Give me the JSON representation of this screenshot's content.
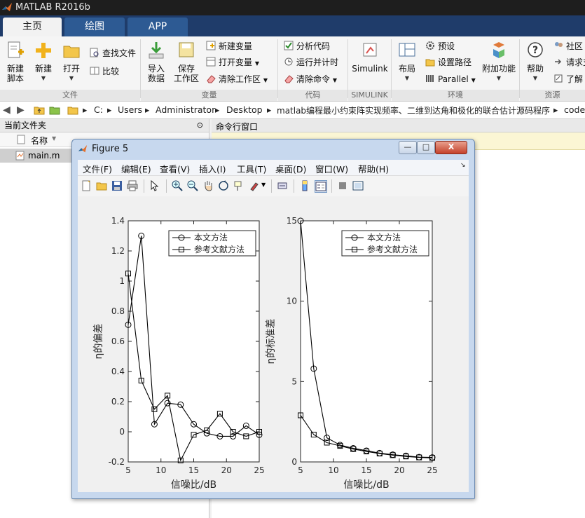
{
  "app": {
    "title": "MATLAB R2016b"
  },
  "tabs": [
    {
      "label": "主页"
    },
    {
      "label": "绘图"
    },
    {
      "label": "APP"
    }
  ],
  "ribbon": {
    "groups": [
      "文件",
      "变量",
      "代码",
      "SIMULINK",
      "环境",
      "资源"
    ],
    "new_script": "新建\n脚本",
    "new": "新建",
    "open": "打开",
    "find_files": "查找文件",
    "compare": "比较",
    "import_data": "导入\n数据",
    "save_workspace": "保存\n工作区",
    "new_variable": "新建变量",
    "open_variable": "打开变量",
    "clear_workspace": "清除工作区",
    "analyze_code": "分析代码",
    "run_and_time": "运行并计时",
    "clear_commands": "清除命令",
    "simulink": "Simulink",
    "layout": "布局",
    "preferences": "预设",
    "set_path": "设置路径",
    "parallel": "Parallel",
    "addons": "附加功能",
    "help": "帮助",
    "community": "社区",
    "request_support": "请求支",
    "learn": "了解"
  },
  "address": {
    "crumbs": [
      "C:",
      "Users",
      "Administrator",
      "Desktop",
      "matlab编程最小约束阵实现频率、二维到达角和极化的联合估计源码程序",
      "code"
    ]
  },
  "left_panel": {
    "title": "当前文件夹",
    "column_name": "名称",
    "files": [
      {
        "name": "main.m"
      }
    ]
  },
  "command_window": {
    "title": "命令行窗口"
  },
  "figure": {
    "title": "Figure 5",
    "menus": [
      "文件(F)",
      "编辑(E)",
      "查看(V)",
      "插入(I)",
      "工具(T)",
      "桌面(D)",
      "窗口(W)",
      "帮助(H)"
    ],
    "win_buttons": {
      "min": "—",
      "max": "□",
      "close": "X"
    }
  },
  "chart_data": [
    {
      "type": "line",
      "xlabel": "信噪比/dB",
      "ylabel": "η的偏差",
      "xlim": [
        5,
        25
      ],
      "ylim": [
        -0.2,
        1.4
      ],
      "xticks": [
        5,
        10,
        15,
        20,
        25
      ],
      "yticks": [
        -0.2,
        0,
        0.2,
        0.4,
        0.6,
        0.8,
        1,
        1.2,
        1.4
      ],
      "legend_position": "top-right",
      "x": [
        5,
        7,
        9,
        11,
        13,
        15,
        17,
        19,
        21,
        23,
        25
      ],
      "series": [
        {
          "name": "本文方法",
          "marker": "circle",
          "values": [
            0.71,
            1.3,
            0.05,
            0.19,
            0.18,
            0.05,
            -0.01,
            -0.03,
            -0.03,
            0.04,
            -0.02
          ]
        },
        {
          "name": "参考文献方法",
          "marker": "square",
          "values": [
            1.05,
            0.34,
            0.15,
            0.24,
            -0.19,
            -0.02,
            0.01,
            0.12,
            0.0,
            -0.03,
            0.0
          ]
        }
      ]
    },
    {
      "type": "line",
      "xlabel": "信噪比/dB",
      "ylabel": "η的标准差",
      "xlim": [
        5,
        25
      ],
      "ylim": [
        0,
        15
      ],
      "xticks": [
        5,
        10,
        15,
        20,
        25
      ],
      "yticks": [
        0,
        5,
        10,
        15
      ],
      "legend_position": "top-right",
      "x": [
        5,
        7,
        9,
        11,
        13,
        15,
        17,
        19,
        21,
        23,
        25
      ],
      "series": [
        {
          "name": "本文方法",
          "marker": "circle",
          "values": [
            15.0,
            5.8,
            1.5,
            1.05,
            0.85,
            0.7,
            0.55,
            0.45,
            0.38,
            0.3,
            0.28
          ]
        },
        {
          "name": "参考文献方法",
          "marker": "square",
          "values": [
            2.9,
            1.7,
            1.2,
            1.0,
            0.8,
            0.65,
            0.52,
            0.42,
            0.34,
            0.28,
            0.25
          ]
        }
      ]
    }
  ]
}
